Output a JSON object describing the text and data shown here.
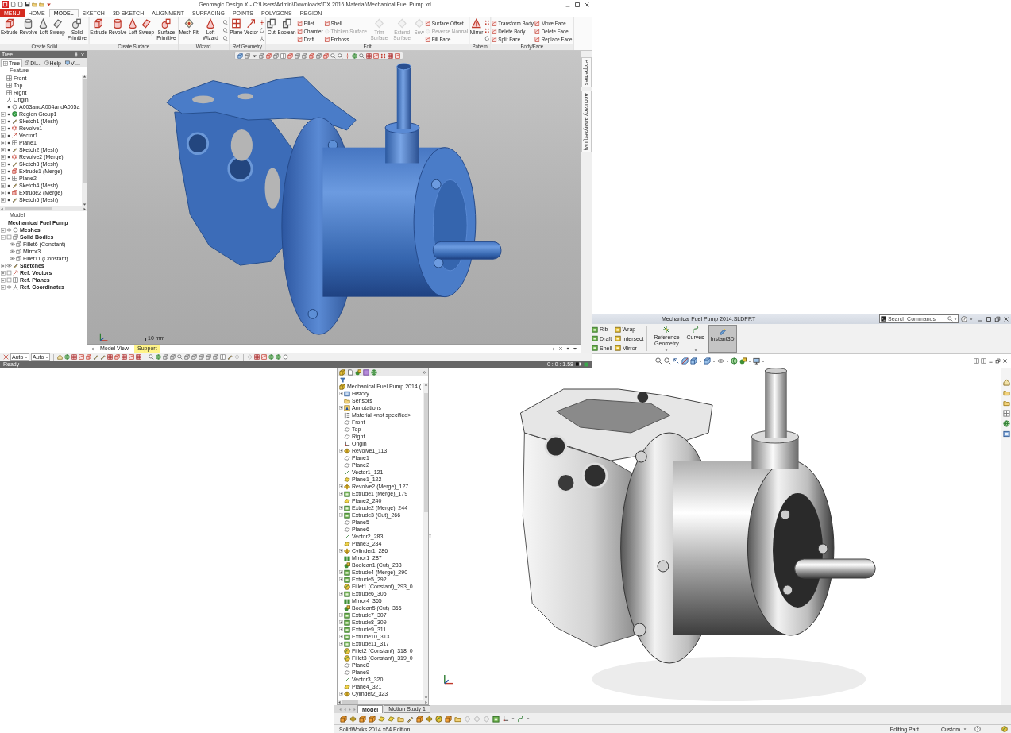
{
  "top_window": {
    "title": "Geomagic Design X - C:\\Users\\Admin\\Downloads\\DX 2016 Material\\Mechanical Fuel Pump.xrl",
    "menu_button": "MENU",
    "tabs": [
      {
        "label": "HOME",
        "selected": false
      },
      {
        "label": "MODEL",
        "selected": true
      },
      {
        "label": "SKETCH",
        "selected": false
      },
      {
        "label": "3D SKETCH",
        "selected": false
      },
      {
        "label": "ALIGNMENT",
        "selected": false
      },
      {
        "label": "SURFACING",
        "selected": false
      },
      {
        "label": "POINTS",
        "selected": false
      },
      {
        "label": "POLYGONS",
        "selected": false
      },
      {
        "label": "REGION",
        "selected": false
      }
    ],
    "ribbon_groups": [
      {
        "label": "Create Solid",
        "items": [
          {
            "kind": "large",
            "label": "Extrude",
            "disabled": false
          },
          {
            "kind": "large",
            "label": "Revolve",
            "disabled": false
          },
          {
            "kind": "large",
            "label": "Loft",
            "disabled": false
          },
          {
            "kind": "large",
            "label": "Sweep",
            "disabled": false
          },
          {
            "kind": "large",
            "label": "Solid Primitive",
            "disabled": false
          }
        ]
      },
      {
        "label": "Create Surface",
        "items": [
          {
            "kind": "large",
            "label": "Extrude",
            "disabled": false
          },
          {
            "kind": "large",
            "label": "Revolve",
            "disabled": false
          },
          {
            "kind": "large",
            "label": "Loft",
            "disabled": false
          },
          {
            "kind": "large",
            "label": "Sweep",
            "disabled": false
          },
          {
            "kind": "large",
            "label": "Surface Primitive",
            "disabled": false
          }
        ]
      },
      {
        "label": "Wizard",
        "items": [
          {
            "kind": "large",
            "label": "Mesh Fit",
            "disabled": false
          },
          {
            "kind": "large",
            "label": "Loft Wizard",
            "disabled": false
          },
          {
            "kind": "icons"
          }
        ]
      },
      {
        "label": "Ref.Geometry",
        "items": [
          {
            "kind": "large",
            "label": "Plane",
            "disabled": false
          },
          {
            "kind": "large",
            "label": "Vector",
            "disabled": false
          },
          {
            "kind": "icons"
          }
        ]
      },
      {
        "label": "Edit",
        "items": [
          {
            "kind": "large",
            "label": "Cut",
            "disabled": false
          },
          {
            "kind": "large",
            "label": "Boolean",
            "disabled": false
          },
          {
            "kind": "stack",
            "tools": [
              {
                "label": "Fillet",
                "disabled": false
              },
              {
                "label": "Chamfer",
                "disabled": false
              },
              {
                "label": "Draft",
                "disabled": false
              }
            ]
          },
          {
            "kind": "stack",
            "tools": [
              {
                "label": "Shell",
                "disabled": false
              },
              {
                "label": "Thicken Surface",
                "disabled": true
              },
              {
                "label": "Emboss",
                "disabled": false
              }
            ]
          },
          {
            "kind": "large",
            "label": "Trim Surface",
            "disabled": true
          },
          {
            "kind": "large",
            "label": "Extend Surface",
            "disabled": true
          },
          {
            "kind": "large",
            "label": "Sew",
            "disabled": true
          },
          {
            "kind": "stack",
            "tools": [
              {
                "label": "Surface Offset",
                "disabled": false
              },
              {
                "label": "Reverse Normal",
                "disabled": true
              },
              {
                "label": "Fill Face",
                "disabled": false
              }
            ]
          }
        ]
      },
      {
        "label": "Pattern",
        "items": [
          {
            "kind": "large",
            "label": "Mirror",
            "disabled": false
          },
          {
            "kind": "icons"
          }
        ]
      },
      {
        "label": "Body/Face",
        "items": [
          {
            "kind": "stack",
            "tools": [
              {
                "label": "Transform Body",
                "disabled": false
              },
              {
                "label": "Delete Body",
                "disabled": false
              },
              {
                "label": "Split Face",
                "disabled": false
              }
            ]
          },
          {
            "kind": "stack",
            "tools": [
              {
                "label": "Move Face",
                "disabled": false
              },
              {
                "label": "Delete Face",
                "disabled": false
              },
              {
                "label": "Replace Face",
                "disabled": false
              }
            ]
          }
        ]
      }
    ],
    "tree_panel": {
      "title": "Tree",
      "tabs": [
        {
          "label": "Tree",
          "selected": true
        },
        {
          "label": "Di...",
          "selected": false
        },
        {
          "label": "Help",
          "selected": false
        },
        {
          "label": "Vi...",
          "selected": false
        }
      ],
      "feature_heading": "Feature",
      "features": [
        {
          "label": "Front",
          "kind": "plane"
        },
        {
          "label": "Top",
          "kind": "plane"
        },
        {
          "label": "Right",
          "kind": "plane"
        },
        {
          "label": "Origin",
          "kind": "origin"
        },
        {
          "label": "A003andA004andA005a",
          "kind": "region",
          "visible": true
        },
        {
          "label": "Region Group1",
          "kind": "region_group",
          "visible": true,
          "expanded": false
        },
        {
          "label": "Sketch1 (Mesh)",
          "kind": "sketch",
          "visible": true,
          "expanded": false
        },
        {
          "label": "Revolve1",
          "kind": "revolve",
          "visible": true,
          "expanded": false
        },
        {
          "label": "Vector1",
          "kind": "vector",
          "visible": true,
          "expanded": false
        },
        {
          "label": "Plane1",
          "kind": "plane",
          "visible": true,
          "expanded": false
        },
        {
          "label": "Sketch2 (Mesh)",
          "kind": "sketch",
          "visible": true,
          "expanded": false
        },
        {
          "label": "Revolve2 (Merge)",
          "kind": "revolve",
          "visible": true,
          "expanded": false
        },
        {
          "label": "Sketch3 (Mesh)",
          "kind": "sketch",
          "visible": true,
          "expanded": false
        },
        {
          "label": "Extrude1 (Merge)",
          "kind": "extrude",
          "visible": true,
          "expanded": false
        },
        {
          "label": "Plane2",
          "kind": "plane",
          "visible": true,
          "expanded": false
        },
        {
          "label": "Sketch4 (Mesh)",
          "kind": "sketch",
          "visible": true,
          "expanded": false
        },
        {
          "label": "Extrude2 (Merge)",
          "kind": "extrude",
          "visible": true,
          "expanded": false
        },
        {
          "label": "Sketch5 (Mesh)",
          "kind": "sketch",
          "visible": true,
          "expanded": false
        }
      ],
      "model_heading": "Model",
      "model_tree": {
        "label": "Mechanical Fuel Pump",
        "children": [
          {
            "label": "Meshes",
            "kind": "mesh",
            "expanded": false,
            "visible": true
          },
          {
            "label": "Solid Bodies",
            "kind": "body",
            "expanded": true,
            "visible": false,
            "children": [
              {
                "label": "Fillet6 (Constant)",
                "kind": "body",
                "visible": true
              },
              {
                "label": "Mirror3",
                "kind": "body",
                "visible": true
              },
              {
                "label": "Fillet11 (Constant)",
                "kind": "body",
                "visible": true
              }
            ]
          },
          {
            "label": "Sketches",
            "kind": "sketch",
            "expanded": false,
            "visible": true
          },
          {
            "label": "Ref. Vectors",
            "kind": "vector",
            "expanded": false,
            "visible": false
          },
          {
            "label": "Ref. Planes",
            "kind": "plane",
            "expanded": false,
            "visible": false
          },
          {
            "label": "Ref. Coordinates",
            "kind": "origin",
            "expanded": false,
            "visible": true
          }
        ]
      }
    },
    "viewport": {
      "scale_label": "10 mm",
      "side_tabs": [
        "Properties",
        "Accuracy Analyzer(TM)"
      ],
      "view_tabs": [
        {
          "label": "Model View",
          "selected": false
        },
        {
          "label": "Support",
          "selected": true
        }
      ]
    },
    "toolbar_fields": [
      {
        "value": "Auto"
      },
      {
        "value": "Auto"
      }
    ],
    "status_bar": {
      "text": "Ready",
      "readout": "0 : 0 : 1.58"
    }
  },
  "bottom_window": {
    "title": "Mechanical Fuel Pump 2014.SLDPRT",
    "search": {
      "placeholder": "Search Commands"
    },
    "ribbon_columns": [
      [
        {
          "label": "Rib"
        },
        {
          "label": "Draft"
        },
        {
          "label": "Shell"
        }
      ],
      [
        {
          "label": "Wrap"
        },
        {
          "label": "Intersect"
        },
        {
          "label": "Mirror"
        }
      ]
    ],
    "ribbon_buttons": [
      {
        "label": "Reference Geometry",
        "dropdown": true,
        "pressed": false
      },
      {
        "label": "Curves",
        "dropdown": true,
        "pressed": false
      },
      {
        "label": "Instant3D",
        "dropdown": false,
        "pressed": true
      }
    ],
    "tree": {
      "label": "Mechanical Fuel Pump 2014 (",
      "children": [
        {
          "label": "History",
          "kind": "history",
          "expanded": false
        },
        {
          "label": "Sensors",
          "kind": "sensors"
        },
        {
          "label": "Annotations",
          "kind": "annotations",
          "expanded": false
        },
        {
          "label": "Material <not specified>",
          "kind": "material"
        },
        {
          "label": "Front",
          "kind": "ref_plane"
        },
        {
          "label": "Top",
          "kind": "ref_plane"
        },
        {
          "label": "Right",
          "kind": "ref_plane"
        },
        {
          "label": "Origin",
          "kind": "origin"
        },
        {
          "label": "Revolve1_113",
          "kind": "revolve",
          "expanded": false
        },
        {
          "label": "Plane1",
          "kind": "ref_plane"
        },
        {
          "label": "Plane2",
          "kind": "ref_plane"
        },
        {
          "label": "Vector1_121",
          "kind": "vector"
        },
        {
          "label": "Plane1_122",
          "kind": "plane"
        },
        {
          "label": "Revolve2 (Merge)_127",
          "kind": "revolve",
          "expanded": false
        },
        {
          "label": "Extrude1 (Merge)_179",
          "kind": "extrude",
          "expanded": false
        },
        {
          "label": "Plane2_240",
          "kind": "plane"
        },
        {
          "label": "Extrude2 (Merge)_244",
          "kind": "extrude",
          "expanded": false
        },
        {
          "label": "Extrude3 (Cut)_266",
          "kind": "extrude",
          "expanded": false
        },
        {
          "label": "Plane5",
          "kind": "ref_plane"
        },
        {
          "label": "Plane6",
          "kind": "ref_plane"
        },
        {
          "label": "Vector2_283",
          "kind": "vector"
        },
        {
          "label": "Plane3_284",
          "kind": "plane"
        },
        {
          "label": "Cylinder1_286",
          "kind": "cylinder",
          "expanded": false
        },
        {
          "label": "Mirror1_287",
          "kind": "mirror"
        },
        {
          "label": "Boolean1 (Cut)_288",
          "kind": "boolean"
        },
        {
          "label": "Extrude4 (Merge)_290",
          "kind": "extrude",
          "expanded": false
        },
        {
          "label": "Extrude5_292",
          "kind": "extrude",
          "expanded": false
        },
        {
          "label": "Fillet1 (Constant)_293_0",
          "kind": "fillet"
        },
        {
          "label": "Extrude6_305",
          "kind": "extrude",
          "expanded": false
        },
        {
          "label": "Mirror4_365",
          "kind": "mirror"
        },
        {
          "label": "Boolean5 (Cut)_366",
          "kind": "boolean"
        },
        {
          "label": "Extrude7_307",
          "kind": "extrude",
          "expanded": false
        },
        {
          "label": "Extrude8_309",
          "kind": "extrude",
          "expanded": false
        },
        {
          "label": "Extrude9_311",
          "kind": "extrude",
          "expanded": false
        },
        {
          "label": "Extrude10_313",
          "kind": "extrude",
          "expanded": false
        },
        {
          "label": "Extrude11_317",
          "kind": "extrude",
          "expanded": false
        },
        {
          "label": "Fillet2 (Constant)_318_0",
          "kind": "fillet"
        },
        {
          "label": "Fillet3 (Constant)_319_0",
          "kind": "fillet"
        },
        {
          "label": "Plane8",
          "kind": "ref_plane"
        },
        {
          "label": "Plane9",
          "kind": "ref_plane"
        },
        {
          "label": "Vector3_320",
          "kind": "vector"
        },
        {
          "label": "Plane4_321",
          "kind": "plane"
        },
        {
          "label": "Cylinder2_323",
          "kind": "cylinder",
          "expanded": false
        }
      ]
    },
    "tabs": [
      {
        "label": "Model",
        "selected": true
      },
      {
        "label": "Motion Study 1",
        "selected": false
      }
    ],
    "status_bar": {
      "edition": "SolidWorks 2014 x64 Edition",
      "mode": "Editing Part",
      "units": "Custom"
    }
  }
}
